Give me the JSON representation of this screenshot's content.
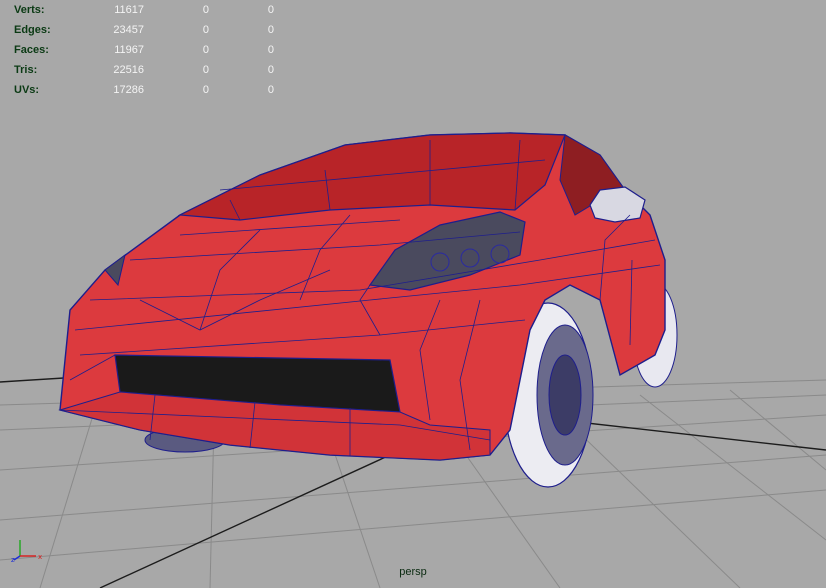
{
  "heads_up_display": {
    "rows": [
      {
        "label": "Verts:",
        "values": [
          "11617",
          "0",
          "0"
        ]
      },
      {
        "label": "Edges:",
        "values": [
          "23457",
          "0",
          "0"
        ]
      },
      {
        "label": "Faces:",
        "values": [
          "11967",
          "0",
          "0"
        ]
      },
      {
        "label": "Tris:",
        "values": [
          "22516",
          "0",
          "0"
        ]
      },
      {
        "label": "UVs:",
        "values": [
          "17286",
          "0",
          "0"
        ]
      }
    ]
  },
  "viewport": {
    "camera_name": "persp",
    "background_color": "#a8a8a8",
    "grid_color": "#7f7f7f",
    "grid_axis_color": "#202020",
    "mesh_color": "#d9383e",
    "wireframe_color": "#1e1e8c"
  },
  "axis_gizmo": {
    "labels": [
      "z",
      "x"
    ],
    "colors": {
      "x": "#d81b1b",
      "y": "#1ea81e",
      "z": "#1b2bd8"
    }
  }
}
